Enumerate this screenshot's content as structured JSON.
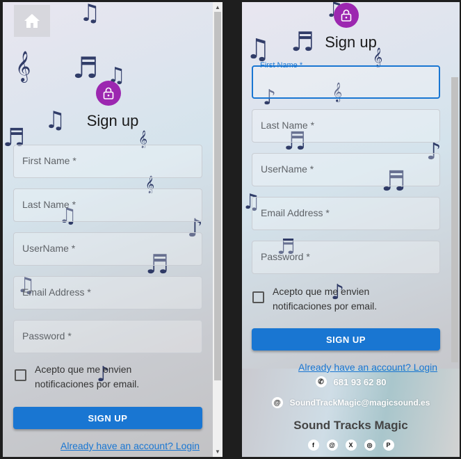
{
  "left": {
    "title": "Sign up",
    "fields": [
      "First Name *",
      "Last Name *",
      "UserName *",
      "Email Address *",
      "Password *"
    ],
    "checkbox_text": "Acepto que me envien notificaciones por email.",
    "submit": "SIGN UP",
    "login_link": "Already have an account? Login"
  },
  "right": {
    "title": "Sign up",
    "fields": [
      "First Name *",
      "Last Name *",
      "UserName *",
      "Email Address *",
      "Password *"
    ],
    "checkbox_text": "Acepto que me envien notificaciones por email.",
    "submit": "SIGN UP",
    "login_link": "Already have an account? Login",
    "footer": {
      "phone": "681 93 62 80",
      "email": "SoundTrackMagic@magicsound.es",
      "brand": "Sound Tracks Magic",
      "socials": [
        "facebook-icon",
        "threads-icon",
        "x-icon",
        "instagram-icon",
        "pinterest-icon"
      ]
    }
  },
  "colors": {
    "primary": "#1976d2",
    "avatar": "#9c27b0"
  }
}
